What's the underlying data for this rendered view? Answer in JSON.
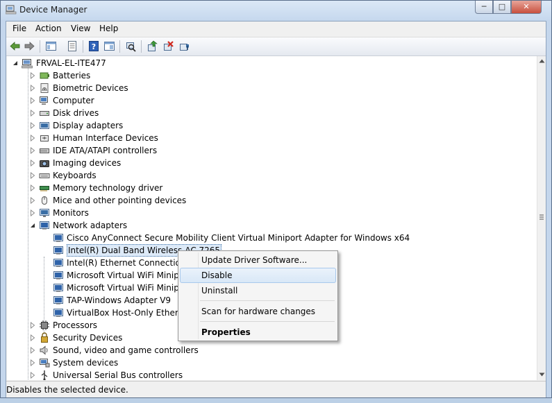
{
  "window": {
    "title": "Device Manager",
    "controls": {
      "minimize": "─",
      "maximize": "□",
      "close": "✕"
    }
  },
  "menubar": [
    "File",
    "Action",
    "View",
    "Help"
  ],
  "toolbar": {
    "icons": [
      "back-icon",
      "forward-icon",
      "show-hide-tree-icon",
      "properties-icon",
      "help-icon",
      "action-pane-icon",
      "scan-hardware-icon",
      "update-driver-icon",
      "uninstall-icon",
      "disable-device-icon"
    ]
  },
  "tree": {
    "root": "FRVAL-EL-ITE477",
    "categories": [
      {
        "label": "Batteries",
        "icon": "battery-icon"
      },
      {
        "label": "Biometric Devices",
        "icon": "fingerprint-icon"
      },
      {
        "label": "Computer",
        "icon": "computer-icon"
      },
      {
        "label": "Disk drives",
        "icon": "disk-drive-icon"
      },
      {
        "label": "Display adapters",
        "icon": "display-adapter-icon"
      },
      {
        "label": "Human Interface Devices",
        "icon": "hid-icon"
      },
      {
        "label": "IDE ATA/ATAPI controllers",
        "icon": "ide-controller-icon"
      },
      {
        "label": "Imaging devices",
        "icon": "camera-icon"
      },
      {
        "label": "Keyboards",
        "icon": "keyboard-icon"
      },
      {
        "label": "Memory technology driver",
        "icon": "memory-icon"
      },
      {
        "label": "Mice and other pointing devices",
        "icon": "mouse-icon"
      },
      {
        "label": "Monitors",
        "icon": "monitor-icon"
      },
      {
        "label": "Network adapters",
        "icon": "network-adapter-icon",
        "expanded": true
      },
      {
        "label": "Processors",
        "icon": "processor-icon"
      },
      {
        "label": "Security Devices",
        "icon": "security-device-icon"
      },
      {
        "label": "Sound, video and game controllers",
        "icon": "sound-icon"
      },
      {
        "label": "System devices",
        "icon": "system-device-icon"
      },
      {
        "label": "Universal Serial Bus controllers",
        "icon": "usb-icon"
      }
    ],
    "network_adapters": [
      "Cisco AnyConnect Secure Mobility Client Virtual Miniport Adapter for Windows x64",
      "Intel(R) Dual Band Wireless-AC 7265",
      "Intel(R) Ethernet Connection (3)",
      "Microsoft Virtual WiFi Miniport",
      "Microsoft Virtual WiFi Miniport",
      "TAP-Windows Adapter V9",
      "VirtualBox Host-Only Ethernet A"
    ]
  },
  "context_menu": {
    "update": "Update Driver Software...",
    "disable": "Disable",
    "uninstall": "Uninstall",
    "scan": "Scan for hardware changes",
    "properties": "Properties"
  },
  "statusbar": {
    "text": "Disables the selected device."
  },
  "colors": {
    "selection_border": "#7da2ce",
    "accent": "#3a6ea5",
    "menu_highlight": "#d9e8f7"
  }
}
